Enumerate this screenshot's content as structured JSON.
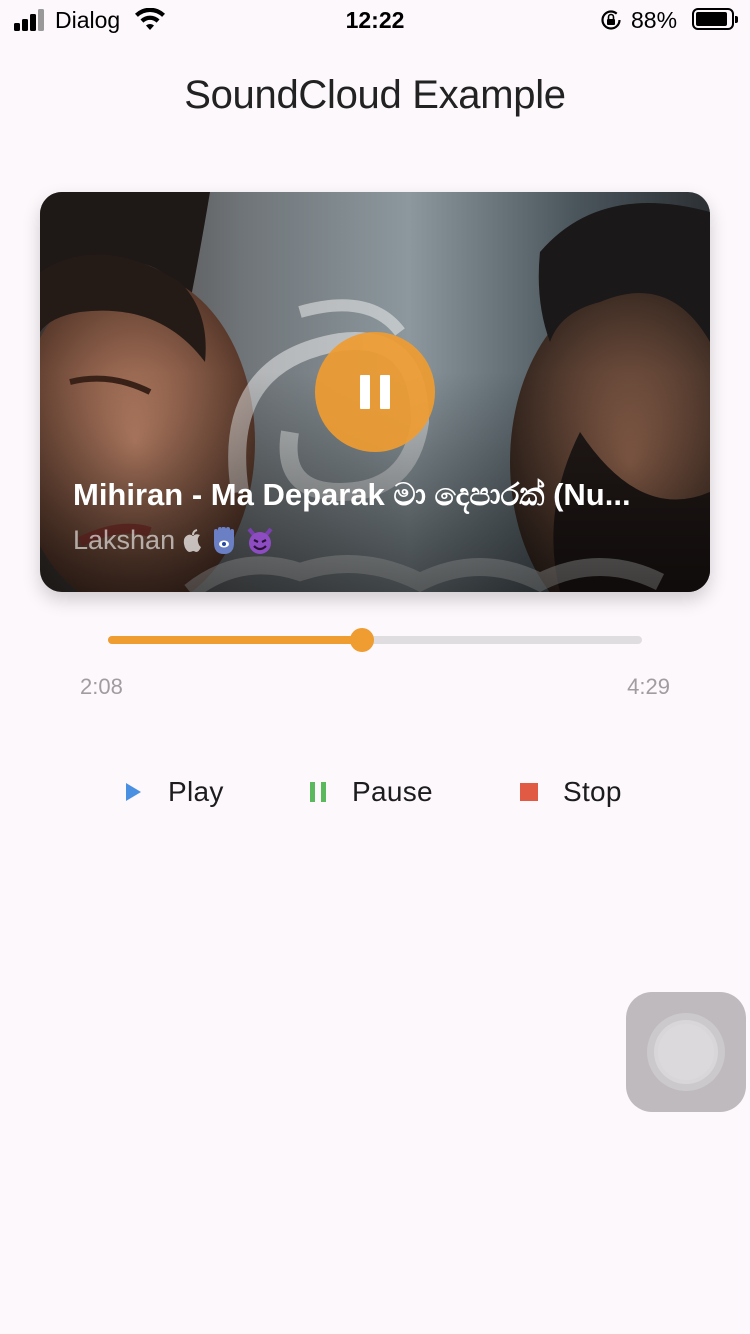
{
  "status_bar": {
    "carrier": "Dialog",
    "time": "12:22",
    "battery_percent": "88%",
    "battery_level": 0.88,
    "icons": [
      "signal-icon",
      "wifi-icon",
      "orientation-lock-icon",
      "battery-icon"
    ]
  },
  "page": {
    "title": "SoundCloud Example"
  },
  "track": {
    "title": "Mihiran - Ma Deparak මා දෙපාරක් (Nu...",
    "artist": "Lakshan",
    "artist_emoji_icons": [
      "apple-icon",
      "hamsa-hand-icon",
      "smiling-devil-icon"
    ],
    "playing": true,
    "toggle_icon": "pause-icon"
  },
  "progress": {
    "elapsed": "2:08",
    "total": "4:29",
    "fraction": 0.476
  },
  "controls": {
    "play_label": "Play",
    "pause_label": "Pause",
    "stop_label": "Stop"
  },
  "colors": {
    "accent": "#ef9c31",
    "play_icon": "#4a90e2",
    "pause_icon": "#5cb85c",
    "stop_icon": "#e05a44",
    "background": "#fcf8fc"
  }
}
